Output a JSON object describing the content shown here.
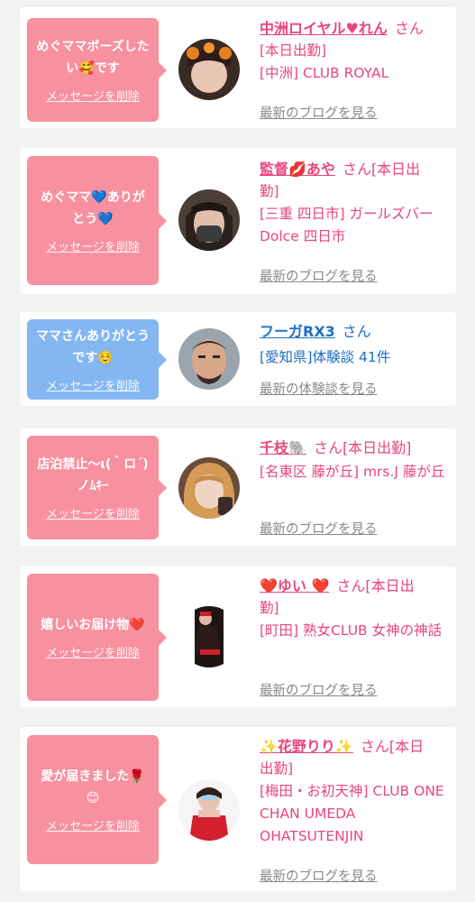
{
  "cards": [
    {
      "message": "めぐママポーズしたい🥰です",
      "delete_label": "メッセージを削除",
      "name": "中洲ロイヤル♥れん",
      "san": "さん",
      "status": "[本日出勤]",
      "shop": "[中洲] CLUB ROYAL",
      "link": "最新のブログを見る"
    },
    {
      "message": "めぐママ💙ありがとう💙",
      "delete_label": "メッセージを削除",
      "name": "監督💋あや",
      "san": "さん[本日出",
      "status": "勤]",
      "shop": "[三重 四日市] ガールズバー Dolce 四日市",
      "link": "最新のブログを見る"
    },
    {
      "message": "ママさんありがとうです☺️",
      "delete_label": "メッセージを削除",
      "name": "フーガRX3",
      "san": "さん",
      "shop": "[愛知県]体験談 41件",
      "link": "最新の体験談を見る"
    },
    {
      "message": "店泊禁止〜ι(｀ロ´)ノﾑｷｰ",
      "delete_label": "メッセージを削除",
      "name": "千枝🐘",
      "san": "さん[本日出勤]",
      "shop": "[名東区 藤が丘] mrs.J 藤が丘",
      "link": "最新のブログを見る"
    },
    {
      "message": "嬉しいお届け物❤️",
      "delete_label": "メッセージを削除",
      "name": "❤️ゆい ❤️",
      "san": "さん[本日出",
      "status": "勤]",
      "shop": "[町田] 熟女CLUB 女神の神話",
      "link": "最新のブログを見る"
    },
    {
      "message": "愛が届きました🌹😊",
      "delete_label": "メッセージを削除",
      "name": "✨花野りり✨",
      "san": "さん[本日",
      "status": "出勤]",
      "shop": "[梅田・お初天神] CLUB ONE CHAN UMEDA OHATSUTENJIN",
      "link": "最新のブログを見る"
    }
  ],
  "colors": {
    "pink_bubble": "#f7909f",
    "blue_bubble": "#84b7f2",
    "name_pink": "#e8467a",
    "name_blue": "#1f6fc5",
    "link_gray": "#888888"
  }
}
